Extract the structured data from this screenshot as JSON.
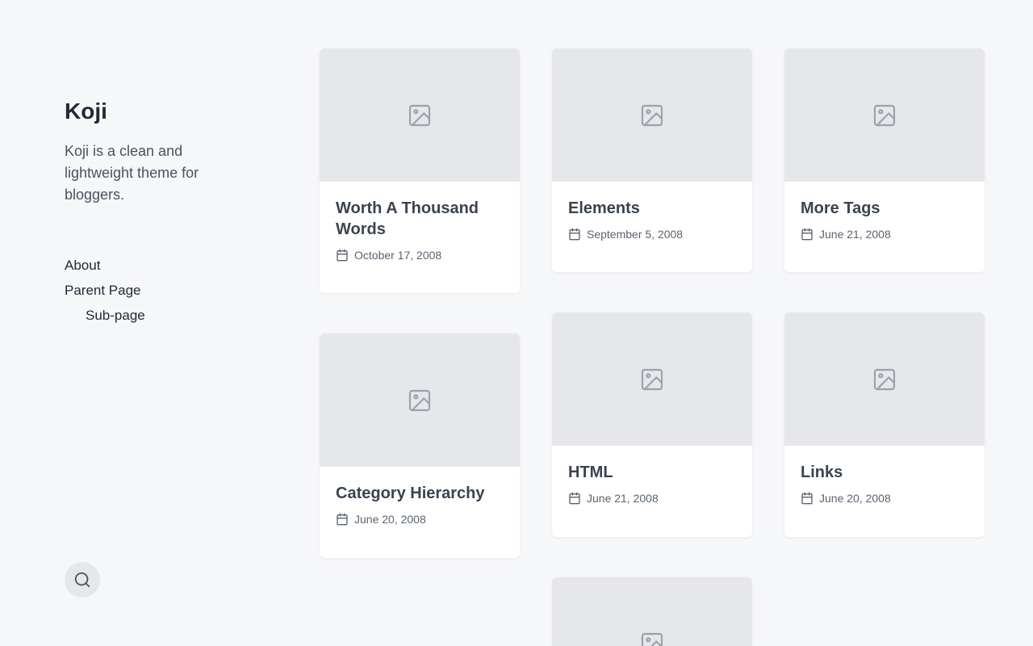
{
  "site": {
    "title": "Koji",
    "description": "Koji is a clean and lightweight theme for bloggers."
  },
  "menu": {
    "about": "About",
    "parent_page": "Parent Page",
    "sub_page": "Sub-page"
  },
  "posts": [
    {
      "title": "Worth A Thousand Words",
      "date": "October 17, 2008"
    },
    {
      "title": "Elements",
      "date": "September 5, 2008"
    },
    {
      "title": "More Tags",
      "date": "June 21, 2008"
    },
    {
      "title": "Category Hierarchy",
      "date": "June 20, 2008"
    },
    {
      "title": "HTML",
      "date": "June 21, 2008"
    },
    {
      "title": "Links",
      "date": "June 20, 2008"
    }
  ],
  "icons": {
    "search": "search-icon",
    "image_placeholder": "image-icon",
    "calendar": "calendar-icon"
  },
  "colors": {
    "background": "#f6f7f9",
    "card": "#ffffff",
    "thumbnail": "#e5e7ea",
    "text": "#232a35",
    "muted": "#5a6270"
  }
}
